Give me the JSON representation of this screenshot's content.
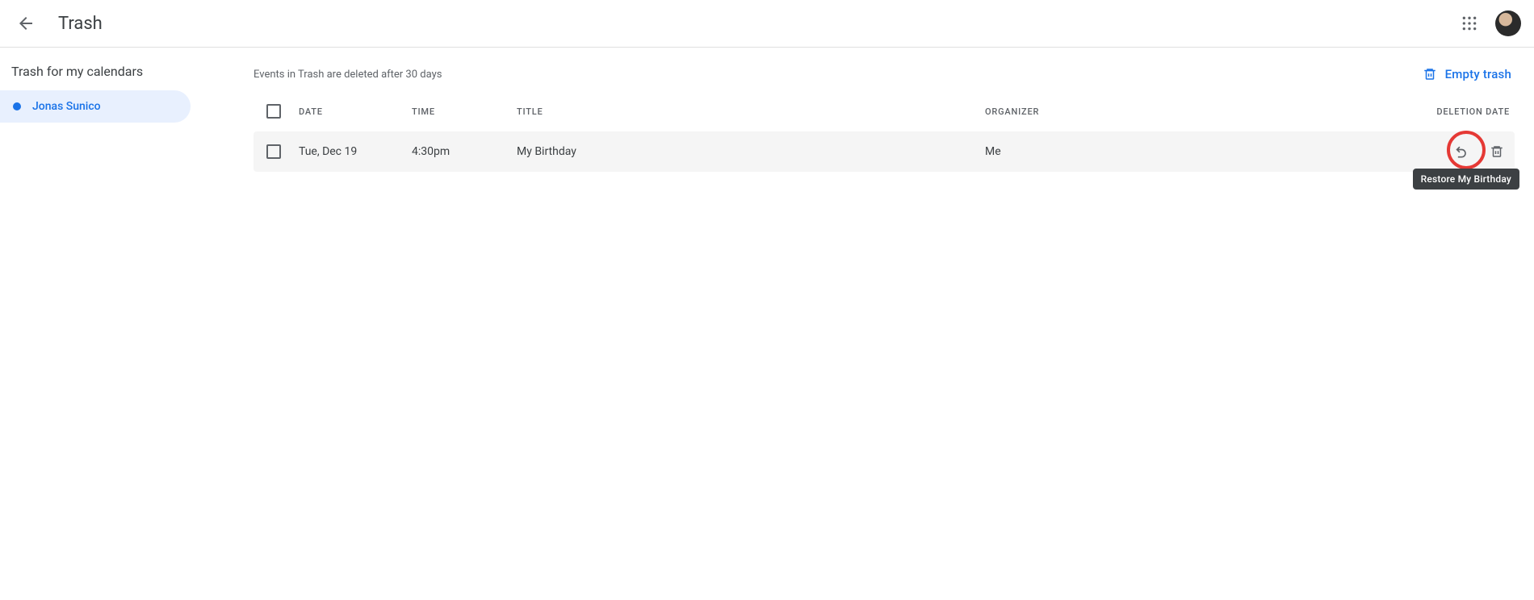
{
  "appbar": {
    "title": "Trash"
  },
  "sidebar": {
    "heading": "Trash for my calendars",
    "items": [
      {
        "label": "Jonas Sunico",
        "color": "#1a73e8",
        "active": true
      }
    ]
  },
  "main": {
    "notice": "Events in Trash are deleted after 30 days",
    "empty_trash_label": "Empty trash",
    "columns": {
      "date": "DATE",
      "time": "TIME",
      "title": "TITLE",
      "organizer": "ORGANIZER",
      "deletion_date": "DELETION DATE"
    },
    "rows": [
      {
        "date": "Tue, Dec 19",
        "time": "4:30pm",
        "title": "My Birthday",
        "organizer": "Me",
        "tooltip": "Restore My Birthday"
      }
    ]
  }
}
